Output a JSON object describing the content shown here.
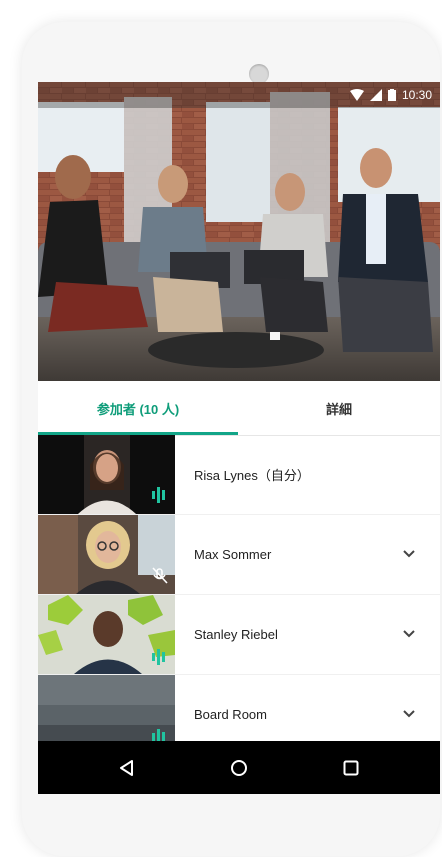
{
  "status_bar": {
    "time": "10:30"
  },
  "tabs": [
    {
      "label": "参加者 (10 人)",
      "active": true
    },
    {
      "label": "詳細",
      "active": false
    }
  ],
  "participants": [
    {
      "name": "Risa Lynes（自分）",
      "audio": "speaking-icon"
    },
    {
      "name": "Max Sommer",
      "audio": "mic-off-icon"
    },
    {
      "name": "Stanley Riebel",
      "audio": "speaking-icon"
    },
    {
      "name": "Board Room",
      "audio": "speaking-icon"
    }
  ],
  "colors": {
    "accent": "#12a588",
    "accent_text": "#0f9d7a",
    "navbar": "#000000"
  }
}
